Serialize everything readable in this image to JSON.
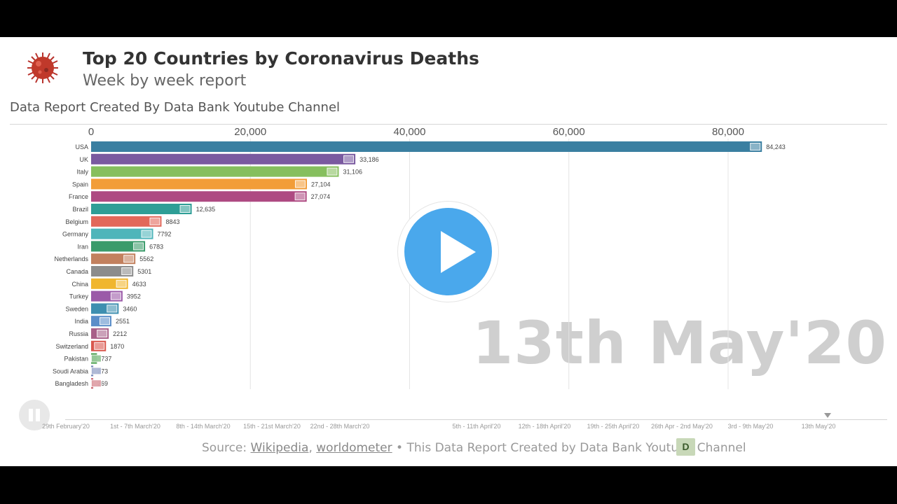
{
  "header": {
    "title": "Top 20 Countries by Coronavirus Deaths",
    "subtitle": "Week by week report",
    "report_label": "Data Report Created By Data Bank Youtube Channel"
  },
  "watermark_date": "13th May'20",
  "footer": {
    "source_prefix": "Source: ",
    "link1": "Wikipedia",
    "sep": ", ",
    "link2": "worldometer",
    "suffix": " • This Data Report Created by Data Bank Youtube Channel",
    "logo_letter": "D"
  },
  "timeline": {
    "labels": [
      "29th February'20",
      "1st - 7th March'20",
      "8th - 14th March'20",
      "15th - 21st March'20",
      "22nd - 28th March'20",
      "5th - 11th April'20",
      "12th - 18th April'20",
      "19th - 25th April'20",
      "26th Apr - 2nd May'20",
      "3rd - 9th May'20",
      "13th May'20"
    ]
  },
  "chart_data": {
    "type": "bar",
    "orientation": "horizontal",
    "title": "Top 20 Countries by Coronavirus Deaths",
    "subtitle": "Week by week report",
    "xlim": [
      0,
      100000
    ],
    "x_ticks": [
      0,
      20000,
      40000,
      60000,
      80000
    ],
    "x_tick_labels": [
      "0",
      "20,000",
      "40,000",
      "60,000",
      "80,000"
    ],
    "grid": true,
    "categories": [
      "USA",
      "UK",
      "Italy",
      "Spain",
      "France",
      "Brazil",
      "Belgium",
      "Germany",
      "Iran",
      "Netherlands",
      "Canada",
      "China",
      "Turkey",
      "Sweden",
      "India",
      "Russia",
      "Switzerland",
      "Pakistan",
      "Soudi Arabia",
      "Bangladesh"
    ],
    "values": [
      84243,
      33186,
      31106,
      27104,
      27074,
      12635,
      8843,
      7792,
      6783,
      5562,
      5301,
      4633,
      3952,
      3460,
      2551,
      2212,
      1870,
      737,
      273,
      269
    ],
    "value_labels": [
      "84,243",
      "33,186",
      "31,106",
      "27,104",
      "27,074",
      "12,635",
      "8843",
      "7792",
      "6783",
      "5562",
      "5301",
      "4633",
      "3952",
      "3460",
      "2551",
      "2212",
      "1870",
      "737",
      "273",
      "269"
    ],
    "colors": [
      "#3a7fa1",
      "#7a5aa0",
      "#86bf5e",
      "#f29d38",
      "#ae4a82",
      "#2e9e96",
      "#e2685a",
      "#4fb5ba",
      "#3a9b6a",
      "#c2805e",
      "#8c8c8c",
      "#f0b62e",
      "#9b5aa8",
      "#3e8fb0",
      "#5b8ec9",
      "#a86089",
      "#d9584e",
      "#4aa04e",
      "#6f82b5",
      "#c95f6a"
    ],
    "flag_icons": [
      "usa-flag-icon",
      "uk-flag-icon",
      "italy-flag-icon",
      "spain-flag-icon",
      "france-flag-icon",
      "brazil-flag-icon",
      "belgium-flag-icon",
      "germany-flag-icon",
      "iran-flag-icon",
      "netherlands-flag-icon",
      "canada-flag-icon",
      "china-flag-icon",
      "turkey-flag-icon",
      "sweden-flag-icon",
      "india-flag-icon",
      "russia-flag-icon",
      "switzerland-flag-icon",
      "pakistan-flag-icon",
      "saudi-arabia-flag-icon",
      "bangladesh-flag-icon"
    ]
  }
}
